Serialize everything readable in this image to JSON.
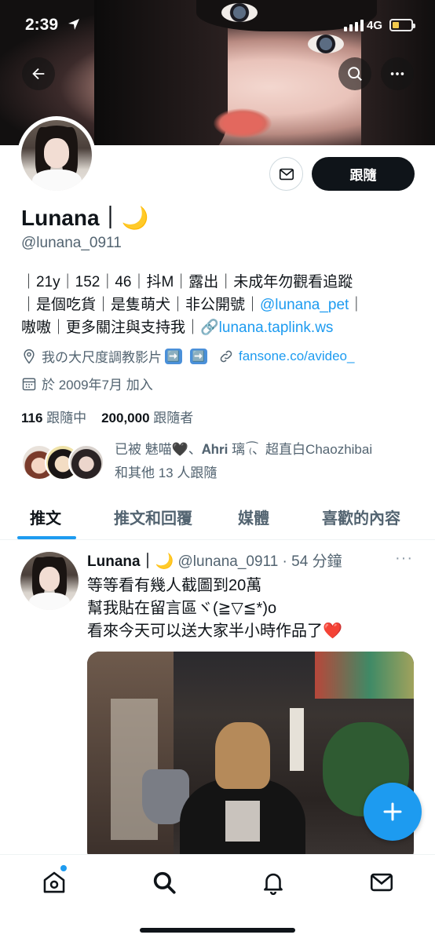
{
  "status_bar": {
    "time": "2:39",
    "network": "4G",
    "signal_bars": 4,
    "battery_level": 0.3
  },
  "header": {
    "back_icon": "arrow-left-icon",
    "search_icon": "search-icon",
    "more_icon": "more-horizontal-icon"
  },
  "profile": {
    "display_name": "Lunana｜🌙",
    "handle": "@lunana_0911",
    "follow_label": "跟隨",
    "bio_line1": "｜21y｜152｜46｜抖M｜露出｜未成年勿觀看追蹤",
    "bio_line2_text": "｜是個吃貨｜是隻萌犬｜非公開號｜",
    "bio_line2_link": "@lunana_pet",
    "bio_line2_end": "｜",
    "bio_line3_text": "嗷嗷｜更多關注與支持我｜🔗",
    "bio_line3_link": "lunana.taplink.ws",
    "location": "我の大尺度調教影片",
    "location_emoji": "➡️",
    "website": "fansone.co/avideo_",
    "joined": "於 2009年7月 加入",
    "following_count": "116",
    "following_label": "跟隨中",
    "followers_count": "200,000",
    "followers_label": "跟隨者",
    "followed_by_line1": "已被 魅喵🖤、𝐀𝐡𝐫𝐢 璃 ₍͡、超直白Chaozhibai",
    "followed_by_line2": "和其他 13 人跟隨"
  },
  "tabs": [
    {
      "label": "推文",
      "active": true
    },
    {
      "label": "推文和回覆",
      "active": false
    },
    {
      "label": "媒體",
      "active": false
    },
    {
      "label": "喜歡的內容",
      "active": false
    }
  ],
  "tweet": {
    "author": "Lunana｜🌙",
    "handle_time": "@lunana_0911 · 54 分鐘",
    "more": "···",
    "line1": "等等看有幾人截圖到20萬",
    "line2": "幫我貼在留言區ヾ(≧▽≦*)o",
    "line3": "看來今天可以送大家半小時作品了❤️"
  },
  "colors": {
    "accent": "#1d9bf0",
    "text": "#0f1419",
    "muted": "#536471"
  },
  "nav": [
    "home-icon",
    "search-icon",
    "bell-icon",
    "mail-icon"
  ]
}
